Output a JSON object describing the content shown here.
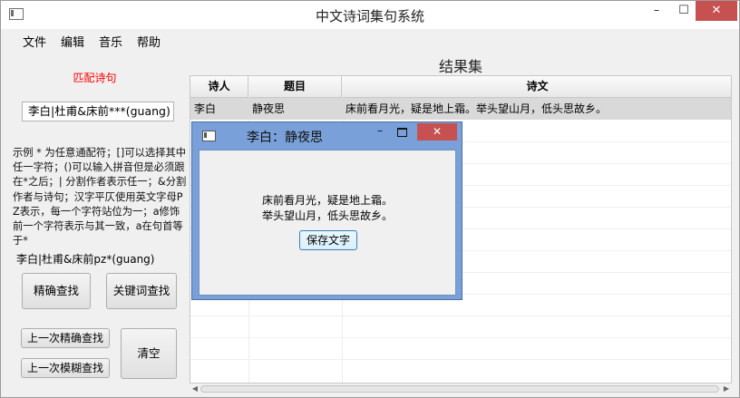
{
  "window": {
    "title": "中文诗词集句系统"
  },
  "menu": [
    "文件",
    "编辑",
    "音乐",
    "帮助"
  ],
  "left": {
    "match_title": "匹配诗句",
    "query_value": "李白|杜甫&床前***(guang)",
    "help_text": "示例 * 为任意通配符；[]可以选择其中任一字符；()可以输入拼音但是必须跟在*之后；| 分割作者表示任一；&分割作者与诗句；汉字平仄使用英文字母PZ表示，每一个字符站位为一；a修饰前一个字符表示与其一致，a在句首等于*",
    "example": "李白|杜甫&床前pz*(guang)",
    "buttons": {
      "exact": "精确查找",
      "keyword": "关键词查找",
      "prev_exact": "上一次精确查找",
      "prev_fuzzy": "上一次模糊查找",
      "clear": "清空"
    }
  },
  "results": {
    "title": "结果集",
    "columns": [
      "诗人",
      "题目",
      "诗文"
    ],
    "rows": [
      {
        "poet": "李白",
        "title": "静夜思",
        "text": "床前看月光，疑是地上霜。举头望山月，低头思故乡。"
      }
    ]
  },
  "dialog": {
    "title": "李白：静夜思",
    "lines": [
      "床前看月光，疑是地上霜。",
      "举头望山月，低头思故乡。"
    ],
    "save_button": "保存文字"
  }
}
